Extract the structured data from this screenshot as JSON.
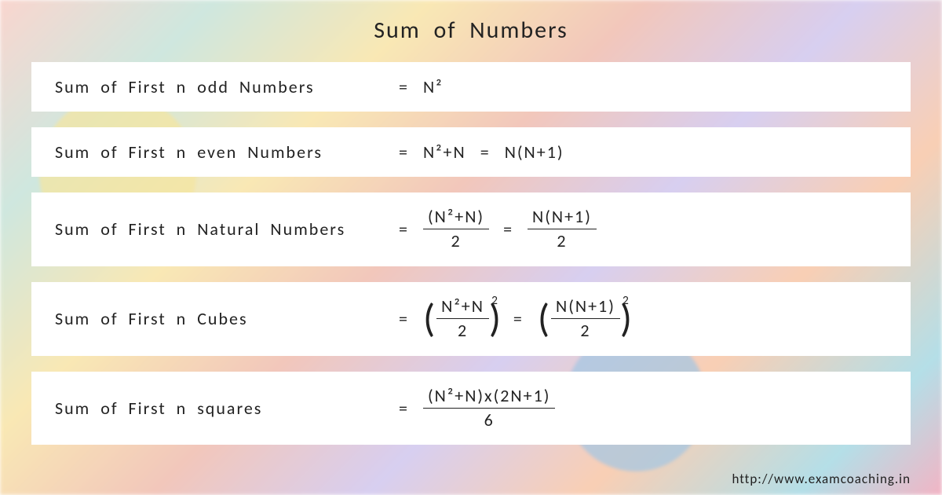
{
  "title": "Sum of Numbers",
  "formulas": {
    "odd": {
      "label": "Sum of First n odd Numbers",
      "rhs1": "N²"
    },
    "even": {
      "label": "Sum of First n even Numbers",
      "rhs1": "N²+N",
      "rhs2": "N(N+1)"
    },
    "natural": {
      "label": "Sum of First n Natural Numbers",
      "frac1_num": "(N²+N)",
      "frac1_den": "2",
      "frac2_num": "N(N+1)",
      "frac2_den": "2"
    },
    "cubes": {
      "label": "Sum of First n Cubes",
      "frac1_num": "N²+N",
      "frac1_den": "2",
      "frac2_num": "N(N+1)",
      "frac2_den": "2",
      "exponent": "2"
    },
    "squares": {
      "label": "Sum of First n squares",
      "frac_num": "(N²+N)x(2N+1)",
      "frac_den": "6"
    }
  },
  "footer_url": "http://www.examcoaching.in"
}
